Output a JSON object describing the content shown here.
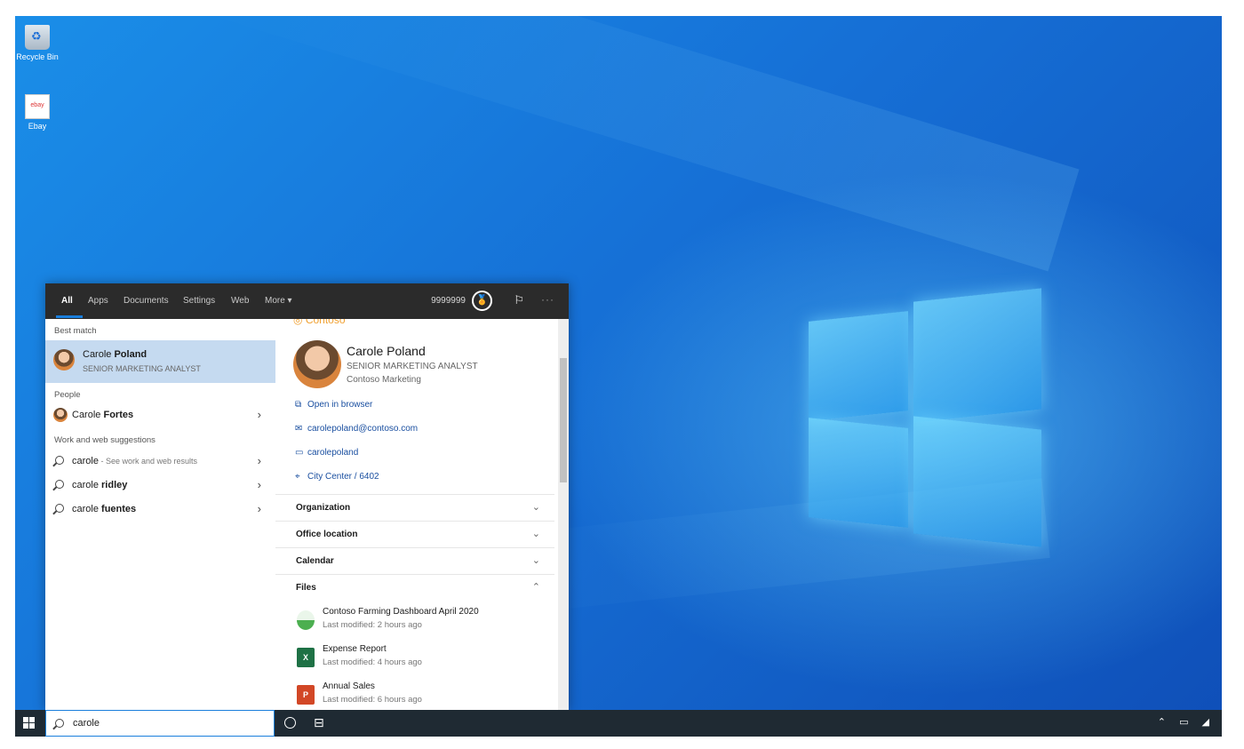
{
  "desktop": {
    "icons": [
      {
        "label": "Recycle Bin"
      },
      {
        "label": "Ebay"
      }
    ]
  },
  "search": {
    "tabs": [
      "All",
      "Apps",
      "Documents",
      "Settings",
      "Web",
      "More ▾"
    ],
    "points": "9999999",
    "best_match_header": "Best match",
    "best_match": {
      "name_first": "Carole",
      "name_last": "Poland",
      "subtitle": "SENIOR MARKETING ANALYST"
    },
    "people_header": "People",
    "people": [
      {
        "name_first": "Carole",
        "name_last": "Fortes"
      }
    ],
    "suggestions_header": "Work and web suggestions",
    "suggestions": [
      {
        "query": "carole",
        "bold": "",
        "sub": " - See work and web results"
      },
      {
        "query": "carole",
        "bold": "ridley",
        "sub": ""
      },
      {
        "query": "carole",
        "bold": "fuentes",
        "sub": ""
      }
    ],
    "query": "carole"
  },
  "profile": {
    "brand": "Contoso",
    "name": "Carole Poland",
    "title": "SENIOR MARKETING ANALYST",
    "department": "Contoso Marketing",
    "links": [
      {
        "icon": "open-browser-icon",
        "label": "Open in browser"
      },
      {
        "icon": "mail-icon",
        "label": "carolepoland@contoso.com"
      },
      {
        "icon": "chat-icon",
        "label": "carolepoland"
      },
      {
        "icon": "location-icon",
        "label": "City Center / 6402"
      }
    ],
    "sections": [
      "Organization",
      "Office location",
      "Calendar",
      "Files"
    ],
    "files": [
      {
        "name": "Contoso Farming Dashboard April 2020",
        "modified": "Last modified: 2 hours ago",
        "type": "dashboard"
      },
      {
        "name": "Expense Report",
        "modified": "Last modified: 4 hours ago",
        "type": "excel"
      },
      {
        "name": "Annual Sales",
        "modified": "Last modified: 6 hours ago",
        "type": "powerpoint"
      }
    ]
  },
  "colors": {
    "accent": "#1a7fdc",
    "link": "#1a4fa0",
    "brand": "#f0a030",
    "selection": "#c5daf0"
  }
}
